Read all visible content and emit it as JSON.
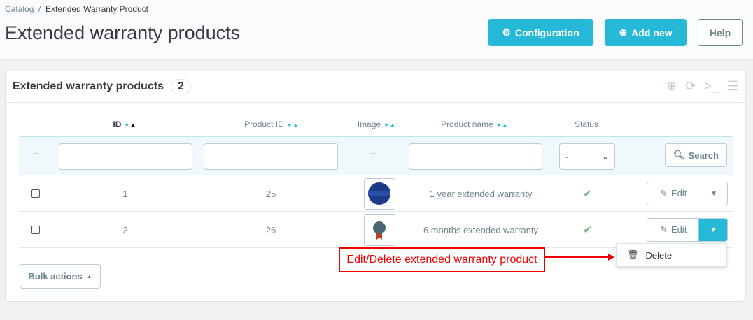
{
  "breadcrumb": [
    "Catalog",
    "Extended Warranty Product"
  ],
  "page_title": "Extended warranty products",
  "toolbar": {
    "configuration": "Configuration",
    "add_new": "Add new",
    "help": "Help"
  },
  "panel": {
    "title": "Extended warranty products",
    "count": "2"
  },
  "columns": [
    "ID",
    "Product ID",
    "Image",
    "Product name",
    "Status"
  ],
  "filters": {
    "placeholder_dash": "--",
    "status_value": "-",
    "search": "Search"
  },
  "rows": [
    {
      "id": "1",
      "product_id": "25",
      "name": "1 year extended warranty",
      "status": "enabled",
      "edit": "Edit"
    },
    {
      "id": "2",
      "product_id": "26",
      "name": "6 months extended warranty",
      "status": "enabled",
      "edit": "Edit"
    }
  ],
  "dropdown": {
    "delete": "Delete"
  },
  "bulk_actions": "Bulk actions",
  "annotation": "Edit/Delete extended warranty product",
  "colors": {
    "accent": "#25b9d7",
    "success": "#70b580",
    "annotation": "#e00000"
  }
}
